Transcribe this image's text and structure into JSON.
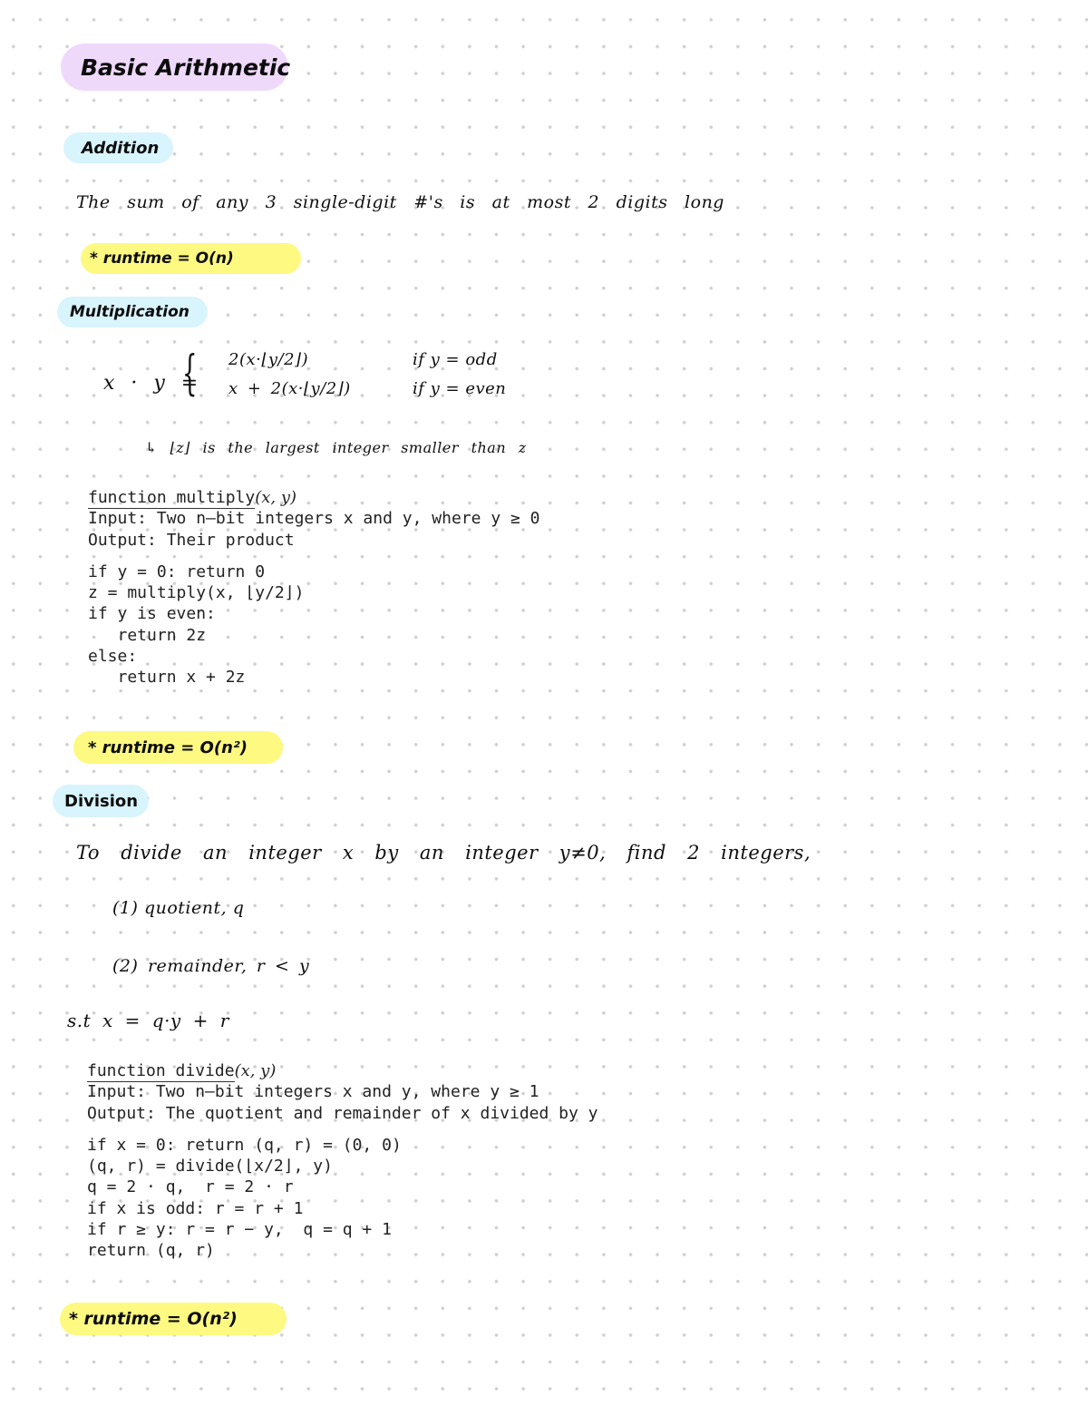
{
  "title": "Basic Arithmetic",
  "addition": {
    "heading": "Addition",
    "note": "The sum of any 3 single-digit #'s is at most 2 digits long",
    "runtime": "* runtime = O(n)"
  },
  "multiplication": {
    "heading": "Multiplication",
    "lhs": "x · y =",
    "cases": [
      {
        "expr": "2(x·⌊y/2⌋)",
        "cond": "if y = odd"
      },
      {
        "expr": "x + 2(x·⌊y/2⌋)",
        "cond": "if y = even"
      }
    ],
    "footnote": "↳ ⌊z⌋ is the largest integer smaller than z",
    "algorithm": {
      "header_name": "function multiply",
      "header_args": "(x, y)",
      "input": "Input: Two n–bit integers x and y, where y ≥ 0",
      "output": "Output: Their product",
      "lines": [
        "if y = 0: return 0",
        "z = multiply(x, ⌊y/2⌋)",
        "if y is even:",
        "   return 2z",
        "else:",
        "   return x + 2z"
      ]
    },
    "runtime": "* runtime = O(n²)"
  },
  "division": {
    "heading": "Division",
    "intro": "To divide an integer x by an integer y≠0, find 2 integers,",
    "items": [
      "(1) quotient, q",
      "(2) remainder, r < y"
    ],
    "such_that": "s.t  x = q·y + r",
    "algorithm": {
      "header_name": "function divide",
      "header_args": "(x, y)",
      "input": "Input: Two n–bit integers x and y, where y ≥ 1",
      "output": "Output: The quotient and remainder of x divided by y",
      "lines": [
        "if x = 0: return (q, r) = (0, 0)",
        "(q, r) = divide(⌊x/2⌋, y)",
        "q = 2 · q,  r = 2 · r",
        "if x is odd: r = r + 1",
        "if r ≥ y: r = r − y,  q = q + 1",
        "return (q, r)"
      ]
    },
    "runtime": "* runtime = O(n²)"
  },
  "colors": {
    "title_highlight": "#efd9fb",
    "section_highlight": "#d8f4fc",
    "runtime_highlight": "#fdf981"
  }
}
